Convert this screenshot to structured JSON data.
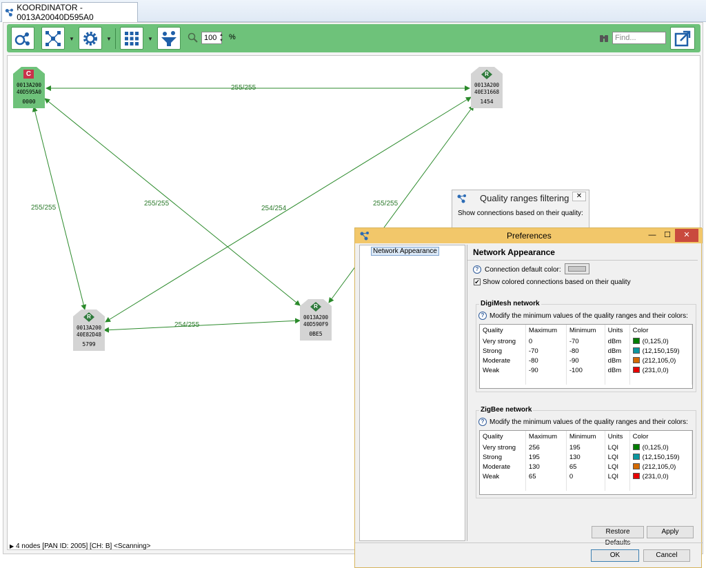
{
  "tab": {
    "title": "KOORDINATOR - 0013A20040D595A0"
  },
  "toolbar": {
    "zoom_value": "100",
    "zoom_unit": "%",
    "find_placeholder": "Find..."
  },
  "nodes": [
    {
      "role": "C",
      "addr1": "0013A200",
      "addr2": "40D595A0",
      "pan": "0000",
      "color": "#6ec27a",
      "badge": "#c9324a"
    },
    {
      "role": "R",
      "addr1": "0013A200",
      "addr2": "40E31668",
      "pan": "1454",
      "color": "#d4d4d4",
      "badge": "#2f7a3c"
    },
    {
      "role": "R",
      "addr1": "0013A200",
      "addr2": "40E82D48",
      "pan": "5799",
      "color": "#d4d4d4",
      "badge": "#2f7a3c"
    },
    {
      "role": "R",
      "addr1": "0013A200",
      "addr2": "40D590F9",
      "pan": "0BE5",
      "color": "#d4d4d4",
      "badge": "#2f7a3c"
    }
  ],
  "edges": [
    {
      "label": "255/255"
    },
    {
      "label": "255/255"
    },
    {
      "label": "255/255"
    },
    {
      "label": "254/254"
    },
    {
      "label": "255/255"
    },
    {
      "label": "254/255"
    }
  ],
  "status": {
    "text": "4 nodes [PAN ID: 2005] [CH: B] <Scanning>"
  },
  "quality_filter": {
    "title": "Quality ranges filtering",
    "subtitle": "Show connections based on their quality:"
  },
  "preferences": {
    "title": "Preferences",
    "tree_item": "Network Appearance",
    "page_title": "Network Appearance",
    "default_color_label": "Connection default color:",
    "show_colored_label": "Show colored connections based on their quality",
    "digimesh": {
      "title": "DigiMesh network",
      "help": "Modify the minimum values of the quality ranges and their colors:",
      "headers": [
        "Quality",
        "Maximum",
        "Minimum",
        "Units",
        "Color"
      ],
      "rows": [
        {
          "quality": "Very strong",
          "max": "0",
          "min": "-70",
          "units": "dBm",
          "color": "(0,125,0)",
          "hex": "#007d00"
        },
        {
          "quality": "Strong",
          "max": "-70",
          "min": "-80",
          "units": "dBm",
          "color": "(12,150,159)",
          "hex": "#0c969f"
        },
        {
          "quality": "Moderate",
          "max": "-80",
          "min": "-90",
          "units": "dBm",
          "color": "(212,105,0)",
          "hex": "#d46900"
        },
        {
          "quality": "Weak",
          "max": "-90",
          "min": "-100",
          "units": "dBm",
          "color": "(231,0,0)",
          "hex": "#e70000"
        }
      ]
    },
    "zigbee": {
      "title": "ZigBee network",
      "help": "Modify the minimum values of the quality ranges and their colors:",
      "headers": [
        "Quality",
        "Maximum",
        "Minimum",
        "Units",
        "Color"
      ],
      "rows": [
        {
          "quality": "Very strong",
          "max": "256",
          "min": "195",
          "units": "LQI",
          "color": "(0,125,0)",
          "hex": "#007d00"
        },
        {
          "quality": "Strong",
          "max": "195",
          "min": "130",
          "units": "LQI",
          "color": "(12,150,159)",
          "hex": "#0c969f"
        },
        {
          "quality": "Moderate",
          "max": "130",
          "min": "65",
          "units": "LQI",
          "color": "(212,105,0)",
          "hex": "#d46900"
        },
        {
          "quality": "Weak",
          "max": "65",
          "min": "0",
          "units": "LQI",
          "color": "(231,0,0)",
          "hex": "#e70000"
        }
      ]
    },
    "buttons": {
      "restore": "Restore Defaults",
      "apply": "Apply",
      "ok": "OK",
      "cancel": "Cancel"
    }
  }
}
